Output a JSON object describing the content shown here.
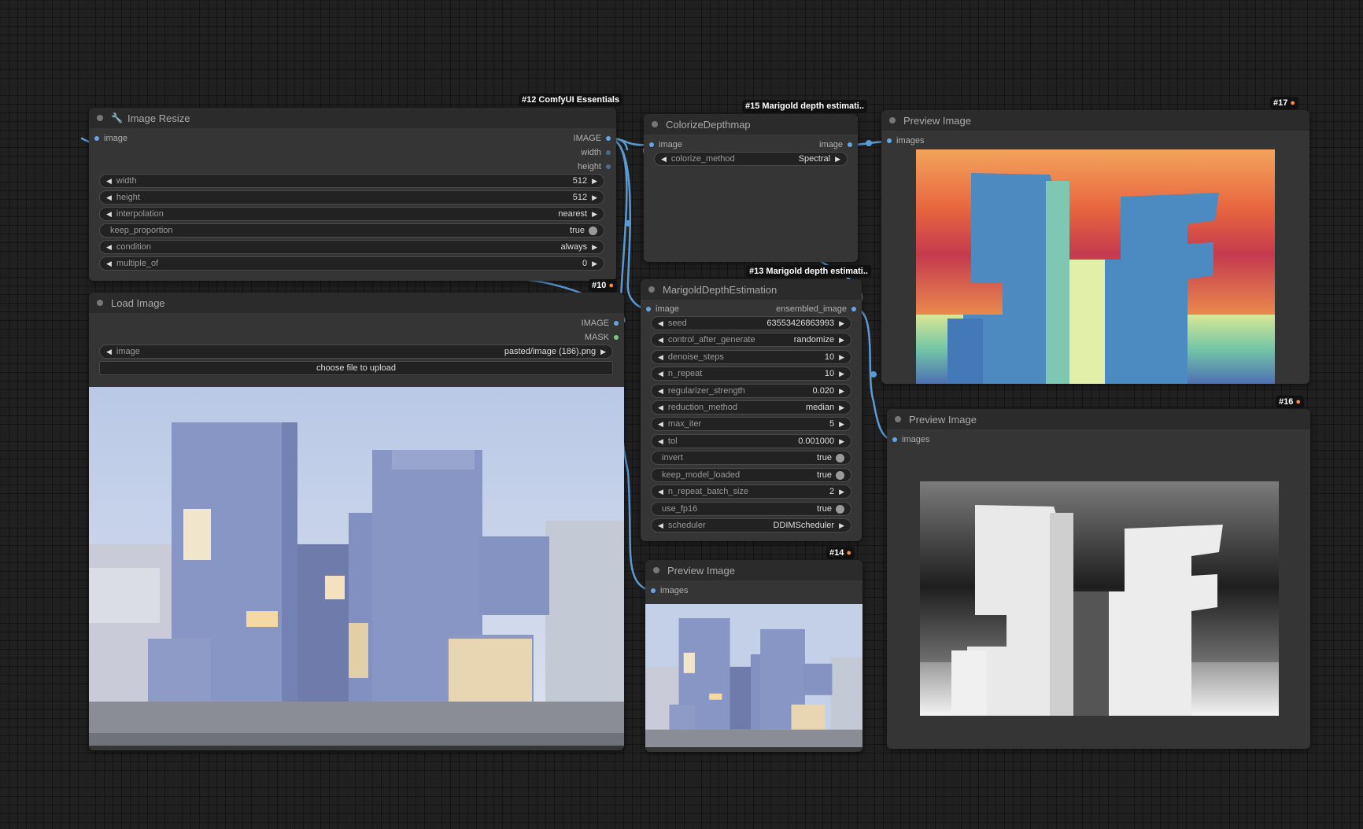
{
  "nodes": {
    "image_resize": {
      "title": "Image Resize",
      "badge": "#12 ComfyUI Essentials",
      "inputs": [
        "image"
      ],
      "outputs": [
        "IMAGE",
        "width",
        "height"
      ],
      "widgets": [
        {
          "label": "width",
          "value": "512"
        },
        {
          "label": "height",
          "value": "512"
        },
        {
          "label": "interpolation",
          "value": "nearest"
        },
        {
          "label": "keep_proportion",
          "value": "true"
        },
        {
          "label": "condition",
          "value": "always"
        },
        {
          "label": "multiple_of",
          "value": "0"
        }
      ]
    },
    "load_image": {
      "title": "Load Image",
      "badge": "#10",
      "outputs": [
        "IMAGE",
        "MASK"
      ],
      "widget_image": {
        "label": "image",
        "value": "pasted/image (186).png"
      },
      "upload_label": "choose file to upload"
    },
    "colorize": {
      "title": "ColorizeDepthmap",
      "badge": "#15 Marigold depth estimati..",
      "input": "image",
      "output": "image",
      "widget": {
        "label": "colorize_method",
        "value": "Spectral"
      }
    },
    "marigold": {
      "title": "MarigoldDepthEstimation",
      "badge": "#13 Marigold depth estimati..",
      "input": "image",
      "output": "ensembled_image",
      "widgets": [
        {
          "label": "seed",
          "value": "63553426863993"
        },
        {
          "label": "control_after_generate",
          "value": "randomize"
        },
        {
          "label": "denoise_steps",
          "value": "10"
        },
        {
          "label": "n_repeat",
          "value": "10"
        },
        {
          "label": "regularizer_strength",
          "value": "0.020"
        },
        {
          "label": "reduction_method",
          "value": "median"
        },
        {
          "label": "max_iter",
          "value": "5"
        },
        {
          "label": "tol",
          "value": "0.001000"
        },
        {
          "label": "invert",
          "value": "true"
        },
        {
          "label": "keep_model_loaded",
          "value": "true"
        },
        {
          "label": "n_repeat_batch_size",
          "value": "2"
        },
        {
          "label": "use_fp16",
          "value": "true"
        },
        {
          "label": "scheduler",
          "value": "DDIMScheduler"
        }
      ]
    },
    "preview14": {
      "title": "Preview Image",
      "badge": "#14",
      "input": "images"
    },
    "preview17": {
      "title": "Preview Image",
      "badge": "#17",
      "input": "images"
    },
    "preview16": {
      "title": "Preview Image",
      "badge": "#16",
      "input": "images"
    }
  },
  "colors": {
    "canvas": "#202020",
    "node_bg": "#353535",
    "node_header": "#2b2b2b",
    "wire": "#5b9bd5",
    "image_slot": "#64a6e8",
    "mask_slot": "#81c784",
    "badge_bg": "#111111"
  },
  "icons": {
    "node_dot": "circle",
    "image_resize": "wrench-icon",
    "badge_mark": "fox-icon",
    "arrows": "triangle-left / triangle-right"
  }
}
